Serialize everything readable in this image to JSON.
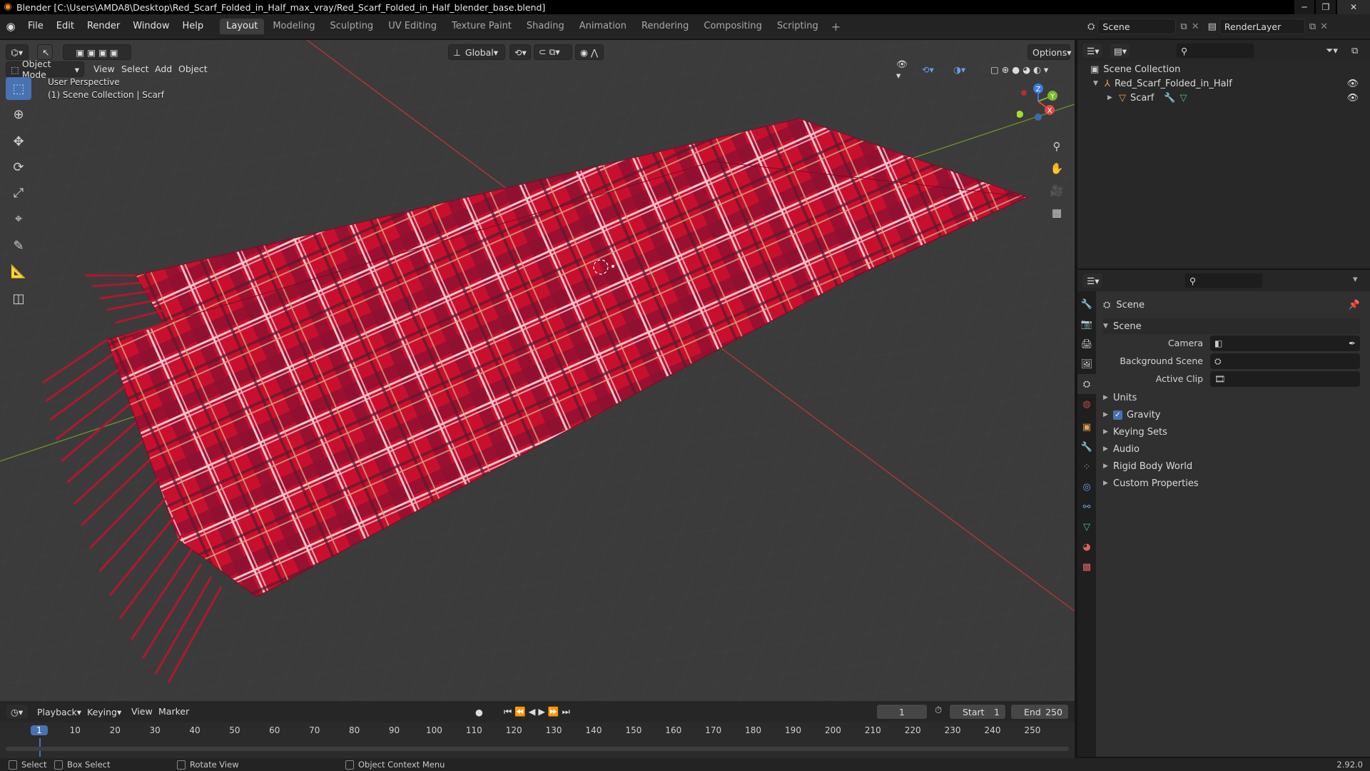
{
  "window": {
    "title": "Blender [C:\\Users\\AMDA8\\Desktop\\Red_Scarf_Folded_in_Half_max_vray/Red_Scarf_Folded_in_Half_blender_base.blend]"
  },
  "menubar": {
    "menus": [
      "File",
      "Edit",
      "Render",
      "Window",
      "Help"
    ],
    "workspaces": [
      "Layout",
      "Modeling",
      "Sculpting",
      "UV Editing",
      "Texture Paint",
      "Shading",
      "Animation",
      "Rendering",
      "Compositing",
      "Scripting"
    ],
    "active_workspace": "Layout",
    "scene": "Scene",
    "view_layer": "RenderLayer"
  },
  "viewport": {
    "mode": "Object Mode",
    "menus": [
      "View",
      "Select",
      "Add",
      "Object"
    ],
    "orientation": "Global",
    "options_label": "Options",
    "overlay_line1": "User Perspective",
    "overlay_line2": "(1) Scene Collection | Scarf",
    "gizmo": {
      "z": "Z",
      "y": "Y",
      "x": "X"
    }
  },
  "outliner": {
    "root": "Scene Collection",
    "collection": "Red_Scarf_Folded_in_Half",
    "object": "Scarf"
  },
  "properties": {
    "header": "Scene",
    "panel": "Scene",
    "fields": [
      {
        "label": "Camera"
      },
      {
        "label": "Background Scene"
      },
      {
        "label": "Active Clip"
      }
    ],
    "subpanels": [
      "Units",
      "Gravity",
      "Keying Sets",
      "Audio",
      "Rigid Body World",
      "Custom Properties"
    ],
    "gravity_checked": true
  },
  "timeline": {
    "menus": [
      "Playback",
      "Keying",
      "View",
      "Marker"
    ],
    "current_frame": "1",
    "start_label": "Start",
    "start": "1",
    "end_label": "End",
    "end": "250",
    "ticks": [
      "1",
      "10",
      "20",
      "30",
      "40",
      "50",
      "60",
      "70",
      "80",
      "90",
      "100",
      "110",
      "120",
      "130",
      "140",
      "150",
      "160",
      "170",
      "180",
      "190",
      "200",
      "210",
      "220",
      "230",
      "240",
      "250"
    ]
  },
  "statusbar": {
    "select": "Select",
    "box_select": "Box Select",
    "rotate_view": "Rotate View",
    "context_menu": "Object Context Menu",
    "version": "2.92.0"
  }
}
